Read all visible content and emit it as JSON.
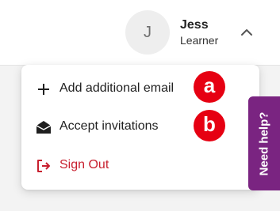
{
  "user": {
    "initial": "J",
    "name": "Jess",
    "role": "Learner",
    "toggle_icon": "chevron-up-icon"
  },
  "menu": {
    "items": [
      {
        "label": "Add additional email",
        "icon": "plus-icon"
      },
      {
        "label": "Accept invitations",
        "icon": "envelope-open-icon"
      },
      {
        "label": "Sign Out",
        "icon": "sign-out-icon",
        "color": "#c8202f"
      }
    ]
  },
  "markers": [
    "a",
    "b"
  ],
  "help": {
    "label": "Need help?",
    "color": "#7a2481"
  },
  "colors": {
    "marker": "#e60012",
    "accent_danger": "#c8202f"
  }
}
